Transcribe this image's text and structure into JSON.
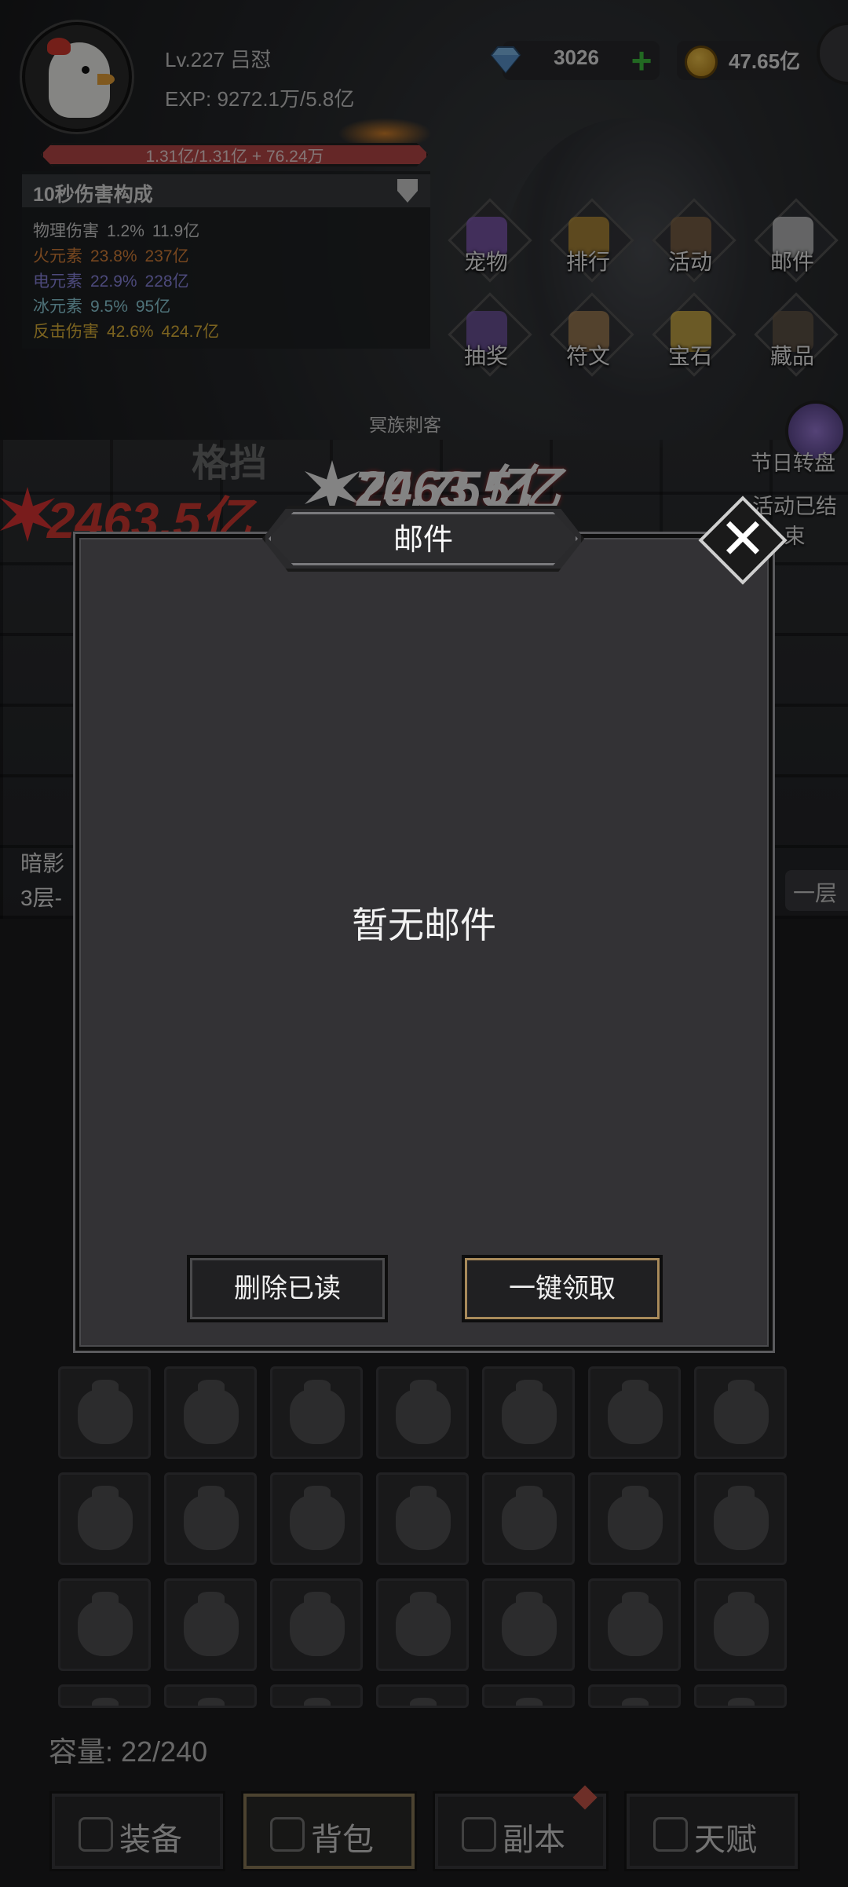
{
  "player": {
    "level_name": "Lv.227 吕怼",
    "exp": "EXP: 9272.1万/5.8亿",
    "hp": "1.31亿/1.31亿 + 76.24万"
  },
  "currency": {
    "gems": "3026",
    "gold": "47.65亿"
  },
  "damage_panel": {
    "title": "10秒伤害构成",
    "rows": [
      {
        "name": "物理伤害",
        "pct": "1.2%",
        "val": "11.9亿",
        "color": "#cfcfcf"
      },
      {
        "name": "火元素",
        "pct": "23.8%",
        "val": "237亿",
        "color": "#d9823a"
      },
      {
        "name": "电元素",
        "pct": "22.9%",
        "val": "228亿",
        "color": "#8a86e0"
      },
      {
        "name": "冰元素",
        "pct": "9.5%",
        "val": "95亿",
        "color": "#8fd0dc"
      },
      {
        "name": "反击伤害",
        "pct": "42.6%",
        "val": "424.7亿",
        "color": "#e0b43a"
      }
    ]
  },
  "menu": [
    {
      "label": "宠物",
      "icon": "pet-icon"
    },
    {
      "label": "排行",
      "icon": "ranking-icon"
    },
    {
      "label": "活动",
      "icon": "event-chest-icon"
    },
    {
      "label": "邮件",
      "icon": "mail-icon"
    },
    {
      "label": "抽奖",
      "icon": "lottery-box-icon"
    },
    {
      "label": "符文",
      "icon": "rune-icon"
    },
    {
      "label": "宝石",
      "icon": "gem-icon"
    },
    {
      "label": "藏品",
      "icon": "collection-icon"
    }
  ],
  "battle": {
    "enemy_name": "冥族刺客",
    "block_text": "格挡",
    "damage_1": "70.75亿",
    "damage_2": "2463.5亿"
  },
  "side": {
    "festival": "节日转盘",
    "event_ended": "活动已结束"
  },
  "stage": {
    "line1": "暗影",
    "line2": "3层-",
    "floor_btn": "一层"
  },
  "inventory": {
    "capacity": "容量: 22/240"
  },
  "tabs": [
    {
      "label": "装备",
      "icon": "trident-icon"
    },
    {
      "label": "背包",
      "icon": "backpack-icon"
    },
    {
      "label": "副本",
      "icon": "dungeon-gate-icon"
    },
    {
      "label": "天赋",
      "icon": "talent-book-icon"
    }
  ],
  "mail_dialog": {
    "title": "邮件",
    "empty_text": "暂无邮件",
    "delete_read": "删除已读",
    "claim_all": "一键领取"
  },
  "colors": {
    "hp_bar": "#b94848",
    "gold_border": "#a88a5a",
    "plus": "#3fbf3f"
  }
}
